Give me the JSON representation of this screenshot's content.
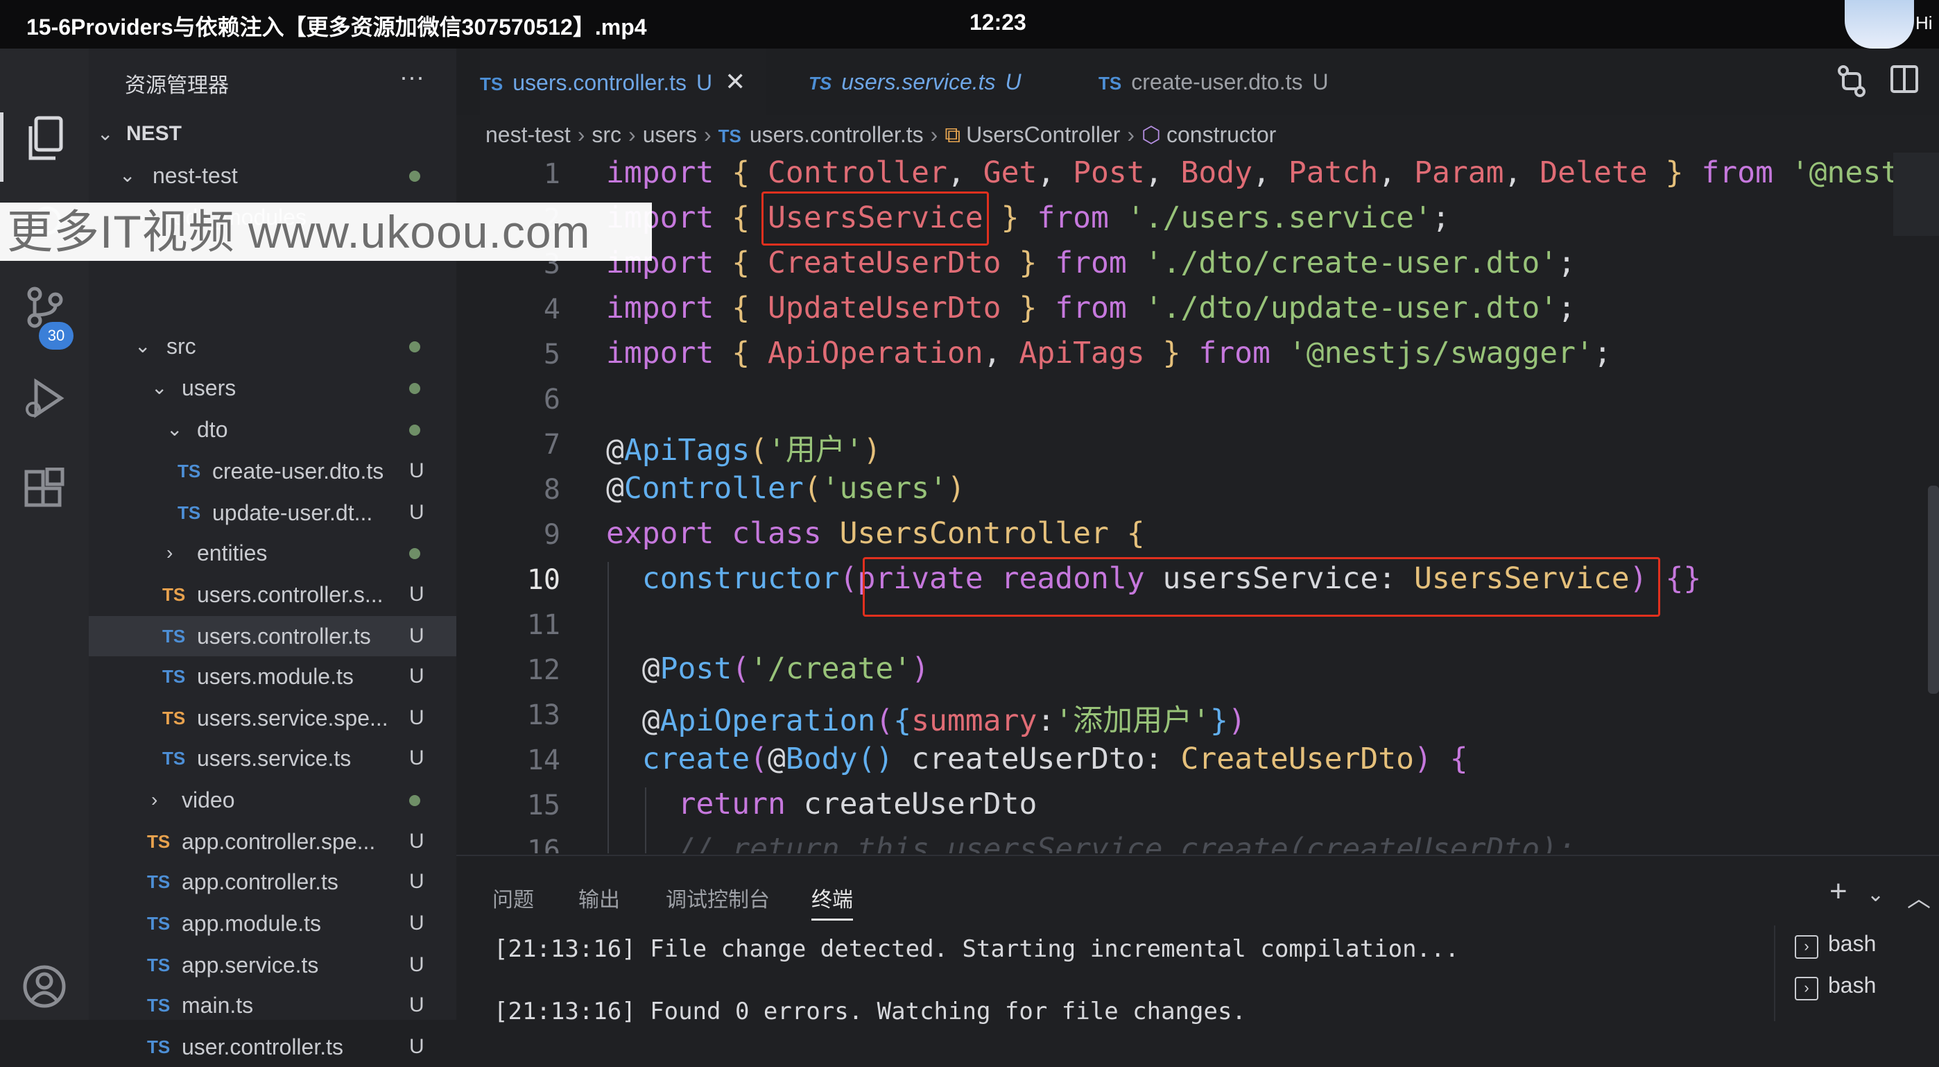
{
  "video": {
    "title": "15-6Providers与依赖注入【更多资源加微信307570512】.mp4",
    "time": "12:23",
    "hi": "Hi"
  },
  "watermark": "更多IT视频 www.ukoou.com",
  "activity": {
    "badge": "30"
  },
  "sidebar": {
    "header": "资源管理器",
    "more": "···",
    "items": [
      {
        "label": "NEST",
        "kind": "section"
      },
      {
        "label": "nest-test",
        "status": "dot"
      },
      {
        "label": "node_modules"
      },
      {
        "label": "src",
        "status": "dot"
      },
      {
        "label": "users",
        "status": "dot"
      },
      {
        "label": "dto",
        "status": "dot"
      },
      {
        "label": "create-user.dto.ts",
        "ts": "TS",
        "status": "U"
      },
      {
        "label": "update-user.dt...",
        "ts": "TS",
        "status": "U"
      },
      {
        "label": "entities",
        "status": "dot"
      },
      {
        "label": "users.controller.s...",
        "ts": "TS",
        "status": "U"
      },
      {
        "label": "users.controller.ts",
        "ts": "TS",
        "status": "U"
      },
      {
        "label": "users.module.ts",
        "ts": "TS",
        "status": "U"
      },
      {
        "label": "users.service.spe...",
        "ts": "TS",
        "status": "U"
      },
      {
        "label": "users.service.ts",
        "ts": "TS",
        "status": "U"
      },
      {
        "label": "video",
        "status": "dot"
      },
      {
        "label": "app.controller.spe...",
        "ts": "TS",
        "status": "U"
      },
      {
        "label": "app.controller.ts",
        "ts": "TS",
        "status": "U"
      },
      {
        "label": "app.module.ts",
        "ts": "TS",
        "status": "U"
      },
      {
        "label": "app.service.ts",
        "ts": "TS",
        "status": "U"
      },
      {
        "label": "main.ts",
        "ts": "TS",
        "status": "U"
      },
      {
        "label": "user.controller.ts",
        "ts": "TS",
        "status": "U"
      }
    ]
  },
  "tabs": [
    {
      "ts": "TS",
      "label": "users.controller.ts",
      "status": "U",
      "close": "✕"
    },
    {
      "ts": "TS",
      "label": "users.service.ts",
      "status": "U"
    },
    {
      "ts": "TS",
      "label": "create-user.dto.ts",
      "status": "U"
    }
  ],
  "breadcrumb": {
    "p1": "nest-test",
    "p2": "src",
    "p3": "users",
    "ts": "TS",
    "p4": "users.controller.ts",
    "p5": "UsersController",
    "p6": "constructor"
  },
  "editor": {
    "lines": [
      "1",
      "2",
      "3",
      "4",
      "5",
      "6",
      "7",
      "8",
      "9",
      "10",
      "11",
      "12",
      "13",
      "14",
      "15",
      "16"
    ],
    "current_line": "10"
  },
  "panel": {
    "tabs": [
      "问题",
      "输出",
      "调试控制台",
      "终端"
    ],
    "active_tab": "终端",
    "terminal_lines": [
      "[21:13:16] File change detected. Starting incremental compilation...",
      "[21:13:16] Found 0 errors. Watching for file changes."
    ],
    "terminals": [
      "bash",
      "bash"
    ]
  }
}
